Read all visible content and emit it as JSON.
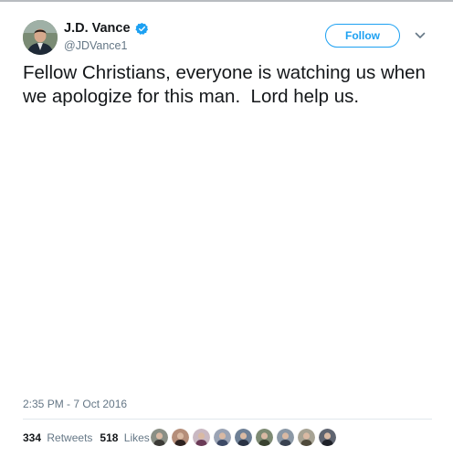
{
  "author": {
    "display_name": "J.D. Vance",
    "handle": "@JDVance1",
    "verified": true,
    "avatar_icon": "profile-photo"
  },
  "actions": {
    "follow_label": "Follow",
    "more_icon": "chevron-down-icon"
  },
  "tweet": {
    "text": "Fellow Christians, everyone is watching us when we apologize for this man.  Lord help us.",
    "timestamp": "2:35 PM - 7 Oct 2016"
  },
  "stats": {
    "retweets_count": "334",
    "retweets_label": "Retweets",
    "likes_count": "518",
    "likes_label": "Likes"
  },
  "likers": [
    {
      "name": "liker-avatar-1",
      "bg": "#8a8f85",
      "fg": "#3b3a36"
    },
    {
      "name": "liker-avatar-2",
      "bg": "#b58e7a",
      "fg": "#2e2220"
    },
    {
      "name": "liker-avatar-3",
      "bg": "#c9b8c2",
      "fg": "#6b3b57"
    },
    {
      "name": "liker-avatar-4",
      "bg": "#9aa3b4",
      "fg": "#3d4a66"
    },
    {
      "name": "liker-avatar-5",
      "bg": "#6d7f95",
      "fg": "#2a3344"
    },
    {
      "name": "liker-avatar-6",
      "bg": "#7d8a73",
      "fg": "#3a4230"
    },
    {
      "name": "liker-avatar-7",
      "bg": "#8b98a6",
      "fg": "#394250"
    },
    {
      "name": "liker-avatar-8",
      "bg": "#a7a394",
      "fg": "#4f4a3b"
    },
    {
      "name": "liker-avatar-9",
      "bg": "#5f6470",
      "fg": "#1f2229"
    }
  ],
  "colors": {
    "accent": "#1da1f2",
    "secondary_text": "#657786",
    "primary_text": "#14171a"
  }
}
